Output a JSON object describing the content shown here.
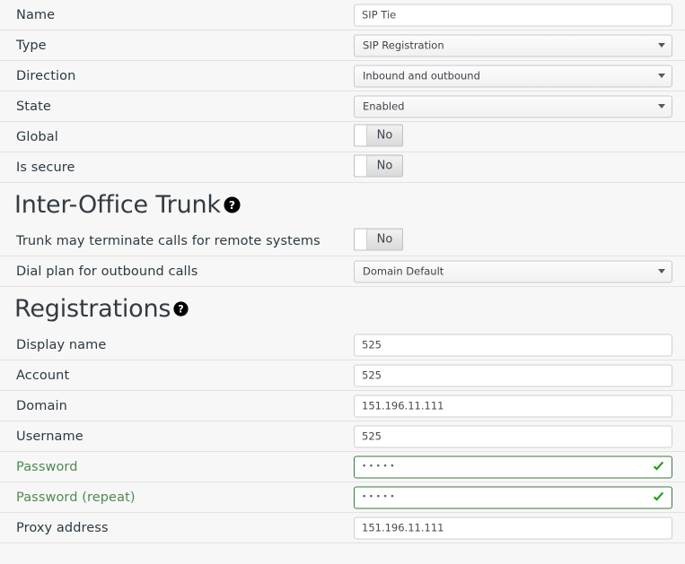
{
  "form": {
    "rows": [
      {
        "label": "Name",
        "control": "text",
        "value": "SIP Tie"
      },
      {
        "label": "Type",
        "control": "select",
        "value": "SIP Registration"
      },
      {
        "label": "Direction",
        "control": "select",
        "value": "Inbound and outbound"
      },
      {
        "label": "State",
        "control": "select",
        "value": "Enabled"
      },
      {
        "label": "Global",
        "control": "toggle",
        "value": "No"
      },
      {
        "label": "Is secure",
        "control": "toggle",
        "value": "No"
      }
    ]
  },
  "inter_office_trunk": {
    "title": "Inter-Office Trunk",
    "help_icon": "help-circle-icon",
    "rows": [
      {
        "label": "Trunk may terminate calls for remote systems",
        "control": "toggle",
        "value": "No"
      },
      {
        "label": "Dial plan for outbound calls",
        "control": "select",
        "value": "Domain Default"
      }
    ]
  },
  "registrations": {
    "title": "Registrations",
    "help_icon": "help-circle-icon",
    "rows": [
      {
        "label": "Display name",
        "control": "text",
        "value": "525"
      },
      {
        "label": "Account",
        "control": "text",
        "value": "525"
      },
      {
        "label": "Domain",
        "control": "text",
        "value": "151.196.11.111"
      },
      {
        "label": "Username",
        "control": "text",
        "value": "525"
      },
      {
        "label": "Password",
        "control": "password",
        "value": "•••••",
        "valid": true,
        "label_color": "#4e8a4e"
      },
      {
        "label": "Password (repeat)",
        "control": "password",
        "value": "•••••",
        "valid": true,
        "label_color": "#4e8a4e"
      },
      {
        "label": "Proxy address",
        "control": "text",
        "value": "151.196.11.111"
      }
    ]
  },
  "colors": {
    "page_background": "#f7f7f7",
    "row_separator": "#e2e2e2",
    "label_text": "#2b3a42",
    "valid_green": "#3b7a3b",
    "check_green": "#18a018",
    "input_border": "#cfcfcf"
  }
}
